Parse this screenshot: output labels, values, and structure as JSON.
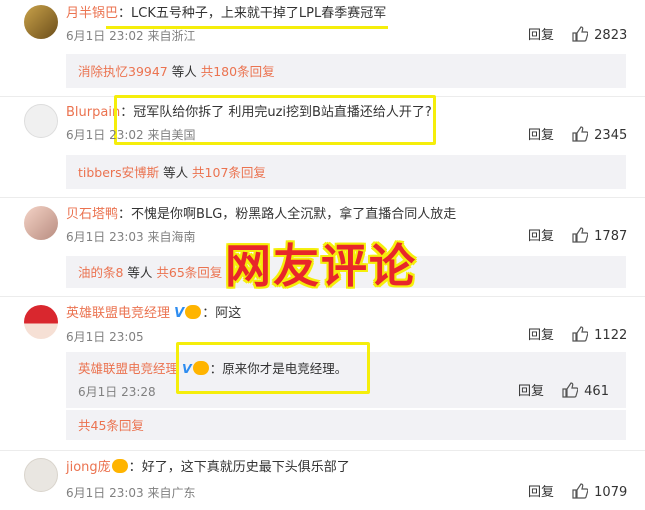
{
  "overlay": {
    "title": "网友评论"
  },
  "comments": [
    {
      "user": "月半锅巴",
      "text": "LCK五号种子，上来就干掉了LPL春季赛冠军",
      "time": "6月1日 23:02",
      "location": "来自浙江",
      "reply_label": "回复",
      "likes": "2823",
      "sub_summary": {
        "users": "消除执忆39947",
        "middle": " 等人 ",
        "count": "共180条回复"
      }
    },
    {
      "user": "Blurpain",
      "text": "冠军队给你拆了 利用完uzi挖到B站直播还给人开了?",
      "time": "6月1日 23:02",
      "location": "来自美国",
      "reply_label": "回复",
      "likes": "2345",
      "sub_summary": {
        "users": "tibbers安博斯",
        "middle": " 等人 ",
        "count": "共107条回复"
      }
    },
    {
      "user": "贝石塔鸭",
      "text": "不愧是你啊BLG，粉黑路人全沉默，拿了直播合同人放走",
      "time": "6月1日 23:03",
      "location": "来自海南",
      "reply_label": "回复",
      "likes": "1787",
      "sub_summary": {
        "users": "油的条8",
        "middle": " 等人 ",
        "count": "共65条回复"
      }
    },
    {
      "user": "英雄联盟电竞经理",
      "text": "阿这",
      "time": "6月1日 23:05",
      "reply_label": "回复",
      "likes": "1122",
      "nested": {
        "user": "英雄联盟电竞经理",
        "text": "原来你才是电竞经理。",
        "time": "6月1日 23:28",
        "reply_label": "回复",
        "likes": "461"
      },
      "sub_summary": {
        "count": "共45条回复"
      }
    },
    {
      "user": "jiong庞",
      "text": "好了，这下真就历史最下头俱乐部了",
      "time": "6月1日 23:03",
      "location": "来自广东",
      "reply_label": "回复",
      "likes": "1079"
    }
  ],
  "colors": {
    "highlight": "#f5ee0b",
    "username": "#eb7350",
    "title_red": "#e8262a"
  }
}
